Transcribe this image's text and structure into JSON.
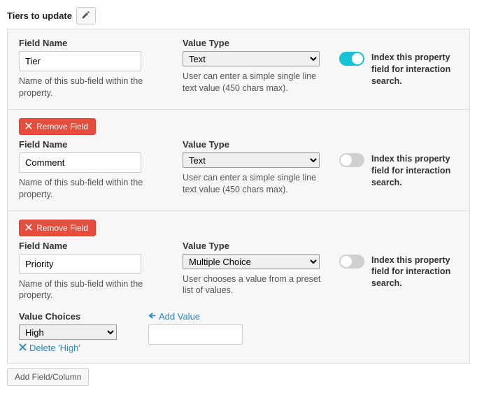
{
  "header": {
    "title": "Tiers to update"
  },
  "labels": {
    "field_name": "Field Name",
    "value_type": "Value Type",
    "remove_field": "Remove Field",
    "field_name_help": "Name of this sub-field within the property.",
    "toggle_label": "Index this property field for interaction search.",
    "text_type_help": "User can enter a simple single line text value (450 chars max).",
    "multi_type_help": "User chooses a value from a preset list of values.",
    "value_choices": "Value Choices",
    "add_value": "Add Value",
    "add_field": "Add Field/Column"
  },
  "value_type_options": {
    "text": "Text",
    "multiple_choice": "Multiple Choice"
  },
  "fields": [
    {
      "name": "Tier",
      "value_type": "Text",
      "indexed": true,
      "removable": false
    },
    {
      "name": "Comment",
      "value_type": "Text",
      "indexed": false,
      "removable": true
    },
    {
      "name": "Priority",
      "value_type": "Multiple Choice",
      "indexed": false,
      "removable": true,
      "choices": {
        "selected": "High",
        "delete_label": "Delete 'High'",
        "new_value": ""
      }
    }
  ]
}
